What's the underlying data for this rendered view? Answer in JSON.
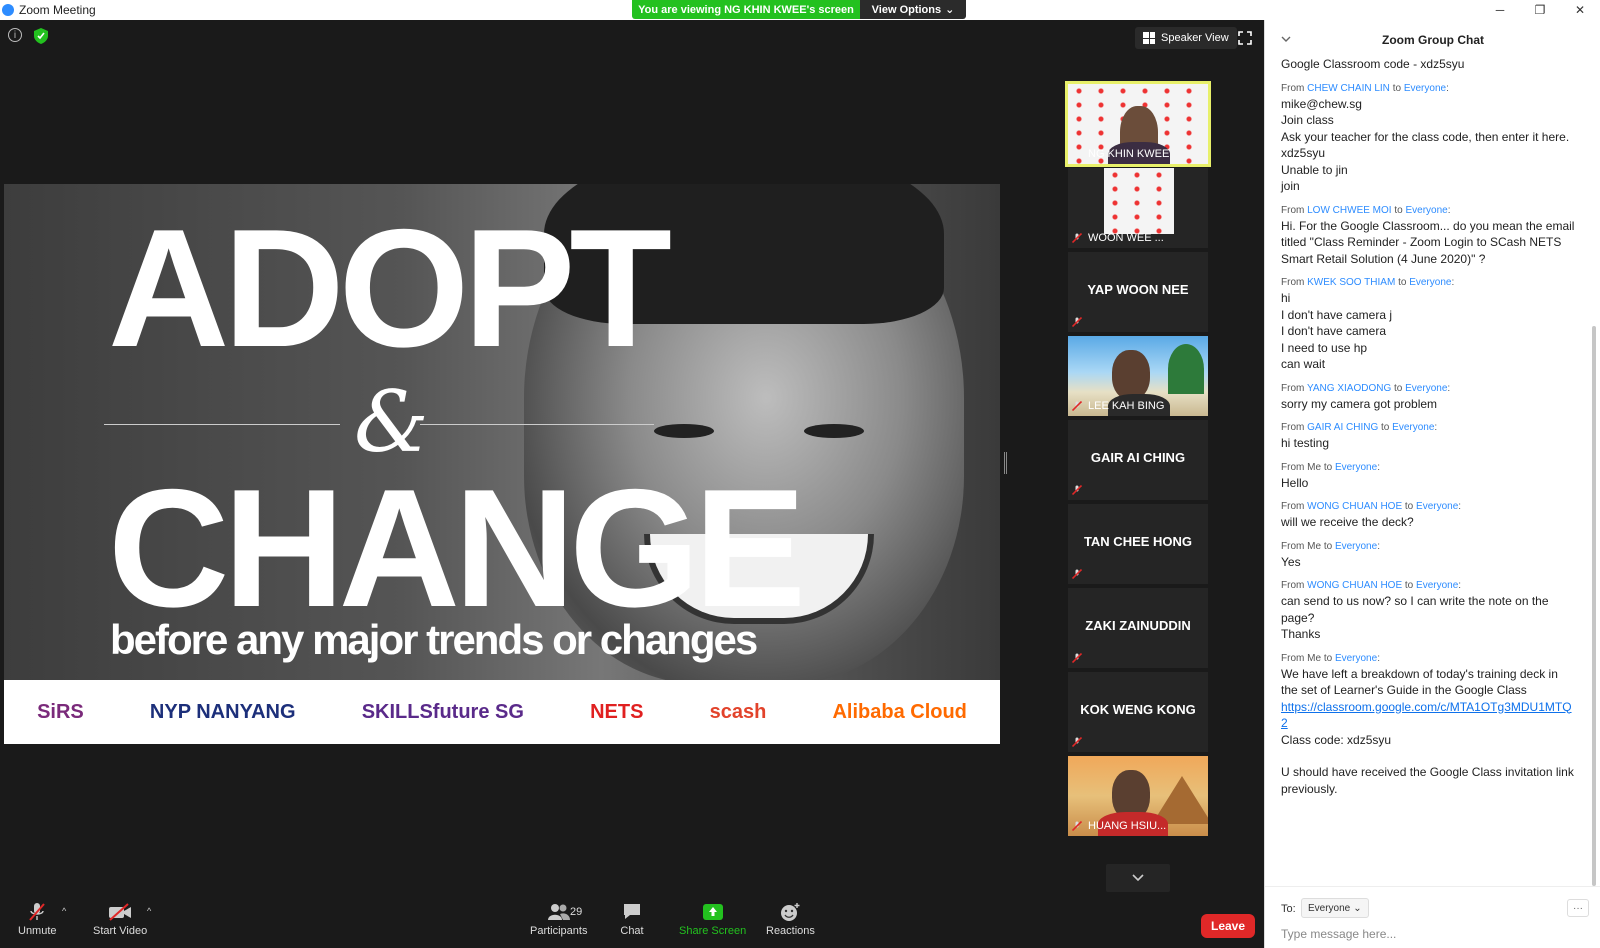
{
  "window": {
    "title": "Zoom Meeting",
    "share_banner": "You are viewing NG KHIN KWEE's screen",
    "view_options": "View Options",
    "controls": [
      "─",
      "❐",
      "✕"
    ]
  },
  "meeting": {
    "speaker_view": "Speaker View"
  },
  "slide": {
    "line1": "ADOPT",
    "amp": "&",
    "line2": "CHANGE",
    "subtitle": "before any major trends or changes",
    "logos": [
      {
        "text": "SiRS",
        "color": "#7a2a7a"
      },
      {
        "text": "NYP NANYANG",
        "color": "#1c2f7a"
      },
      {
        "text": "SKILLSfuture SG",
        "color": "#5a2a8a"
      },
      {
        "text": "NETS",
        "color": "#e02020"
      },
      {
        "text": "scash",
        "color": "#e2432b"
      },
      {
        "text": "Alibaba Cloud",
        "color": "#ff6a00"
      }
    ]
  },
  "participants": [
    {
      "name": "NG KHIN KWEE",
      "type": "video-wall",
      "active": true
    },
    {
      "name": "WOON WEE ...",
      "type": "video-wall-small"
    },
    {
      "name": "YAP WOON NEE",
      "type": "name"
    },
    {
      "name": "LEE KAH BING",
      "type": "video-beach"
    },
    {
      "name": "GAIR AI CHING",
      "type": "name"
    },
    {
      "name": "TAN CHEE HONG",
      "type": "name"
    },
    {
      "name": "ZAKI ZAINUDDIN",
      "type": "name"
    },
    {
      "name": "KOK WENG KONG",
      "type": "name"
    },
    {
      "name": "HUANG HSIU...",
      "type": "video-desert"
    }
  ],
  "toolbar": {
    "unmute": "Unmute",
    "start_video": "Start Video",
    "participants": "Participants",
    "participants_count": "29",
    "chat": "Chat",
    "share_screen": "Share Screen",
    "reactions": "Reactions",
    "leave": "Leave"
  },
  "chat": {
    "title": "Zoom Group Chat",
    "top_partial": "Google Classroom code - xdz5syu",
    "messages": [
      {
        "from": "CHEW CHAIN LIN",
        "to": "Everyone",
        "lines": [
          "mike@chew.sg",
          "Join class",
          "Ask your teacher for the class code, then enter it here.",
          "xdz5syu",
          "Unable to jin",
          "join"
        ]
      },
      {
        "from": "LOW CHWEE MOI",
        "to": "Everyone",
        "lines": [
          "Hi. For the Google Classroom... do you mean the email titled \"Class Reminder - Zoom Login to SCash NETS Smart Retail Solution (4 June 2020)\" ?"
        ]
      },
      {
        "from": "KWEK SOO THIAM",
        "to": "Everyone",
        "lines": [
          "hi",
          "I don't have camera j",
          "I don't have camera",
          "I need to use hp",
          "can wait"
        ]
      },
      {
        "from": "YANG XIAODONG",
        "to": "Everyone",
        "lines": [
          "sorry my camera got problem"
        ]
      },
      {
        "from": "GAIR AI CHING",
        "to": "Everyone",
        "lines": [
          "hi testing"
        ]
      },
      {
        "from": "Me",
        "to": "Everyone",
        "lines": [
          "Hello"
        ]
      },
      {
        "from": "WONG CHUAN HOE",
        "to": "Everyone",
        "lines": [
          "will we receive the deck?"
        ]
      },
      {
        "from": "Me",
        "to": "Everyone",
        "lines": [
          "Yes"
        ]
      },
      {
        "from": "WONG CHUAN HOE",
        "to": "Everyone",
        "lines": [
          "can send to us now? so I can write the note on the page?",
          "Thanks"
        ]
      },
      {
        "from": "Me",
        "to": "Everyone",
        "lines": [
          "We have left a breakdown of today's training deck in the set of Learner's Guide in the Google Class",
          "[link]https://classroom.google.com/c/MTA1OTg3MDU1MTQ2",
          "Class code: xdz5syu",
          "",
          "U should have received the Google Class invitation link previously."
        ]
      }
    ],
    "from_prefix": "From",
    "to_word": "to",
    "to_label": "To:",
    "to_value": "Everyone",
    "more": "···",
    "input_placeholder": "Type message here..."
  }
}
